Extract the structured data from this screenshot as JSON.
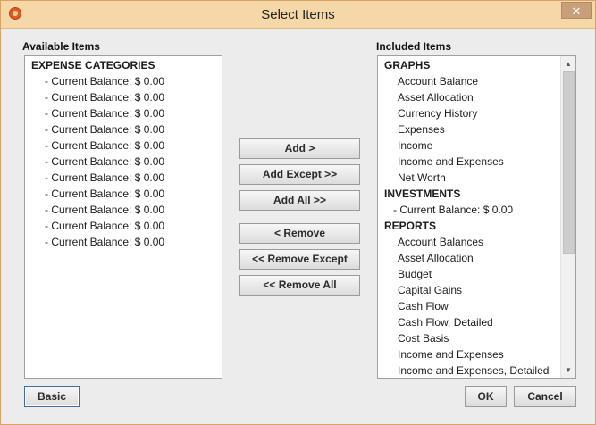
{
  "window": {
    "title": "Select Items",
    "close_glyph": "✕"
  },
  "available": {
    "label": "Available Items",
    "header": "EXPENSE CATEGORIES",
    "items": [
      "- Current Balance: $ 0.00",
      "- Current Balance: $ 0.00",
      "- Current Balance: $ 0.00",
      "- Current Balance: $ 0.00",
      "- Current Balance: $ 0.00",
      "- Current Balance: $ 0.00",
      "- Current Balance: $ 0.00",
      "- Current Balance: $ 0.00",
      "- Current Balance: $ 0.00",
      "- Current Balance: $ 0.00",
      "- Current Balance: $ 0.00"
    ]
  },
  "included": {
    "label": "Included Items",
    "groups": [
      {
        "header": "GRAPHS",
        "items": [
          "Account Balance",
          "Asset Allocation",
          "Currency History",
          "Expenses",
          "Income",
          "Income and Expenses",
          "Net Worth"
        ]
      },
      {
        "header": "INVESTMENTS",
        "items": [
          "- Current Balance: $ 0.00"
        ]
      },
      {
        "header": "REPORTS",
        "items": [
          "Account Balances",
          "Asset Allocation",
          "Budget",
          "Capital Gains",
          "Cash Flow",
          "Cash Flow, Detailed",
          "Cost Basis",
          "Income and Expenses",
          "Income and Expenses, Detailed"
        ]
      }
    ]
  },
  "buttons": {
    "add": "Add >",
    "add_except": "Add Except >>",
    "add_all": "Add All >>",
    "remove": "< Remove",
    "remove_except": "<< Remove Except",
    "remove_all": "<< Remove All",
    "basic": "Basic",
    "ok": "OK",
    "cancel": "Cancel"
  },
  "scrollbar": {
    "up_glyph": "▲",
    "down_glyph": "▼"
  },
  "colors": {
    "titlebar": "#f6d8a8",
    "window_border": "#d9a366"
  }
}
